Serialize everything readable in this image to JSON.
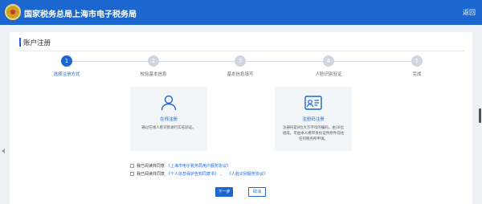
{
  "header": {
    "site_title": "国家税务总局上海市电子税务局",
    "back_label": "返回",
    "brand_color": "#1c67cf"
  },
  "page": {
    "title": "账户注册"
  },
  "steps": [
    {
      "number": "1",
      "label": "选择注册方式",
      "active": true
    },
    {
      "number": "2",
      "label": "校验基本信息",
      "active": false
    },
    {
      "number": "3",
      "label": "基本信息填写",
      "active": false
    },
    {
      "number": "4",
      "label": "人脸识别验证",
      "active": false
    },
    {
      "number": "5",
      "label": "完成",
      "active": false
    }
  ],
  "options": [
    {
      "icon": "person-icon",
      "label": "在线注册",
      "description": "通过在线人脸识别进行实名验证。"
    },
    {
      "icon": "id-card-icon",
      "label": "注册码注册",
      "description": "注册码是8位大写字母的编码，由16位组成。可由本人携带身份证件原件前往任何税务所申请。"
    }
  ],
  "agreements": [
    {
      "prefix": "我已阅读并同意",
      "links": [
        "《上海市电子税务局用户服务协议》"
      ]
    },
    {
      "prefix": "我已阅读并同意",
      "links": [
        "《个人信息保护告知同意书》",
        "《人脸识别服务协议》"
      ],
      "separator": "、"
    }
  ],
  "buttons": {
    "next_label": "下一步",
    "cancel_label": "取消"
  }
}
